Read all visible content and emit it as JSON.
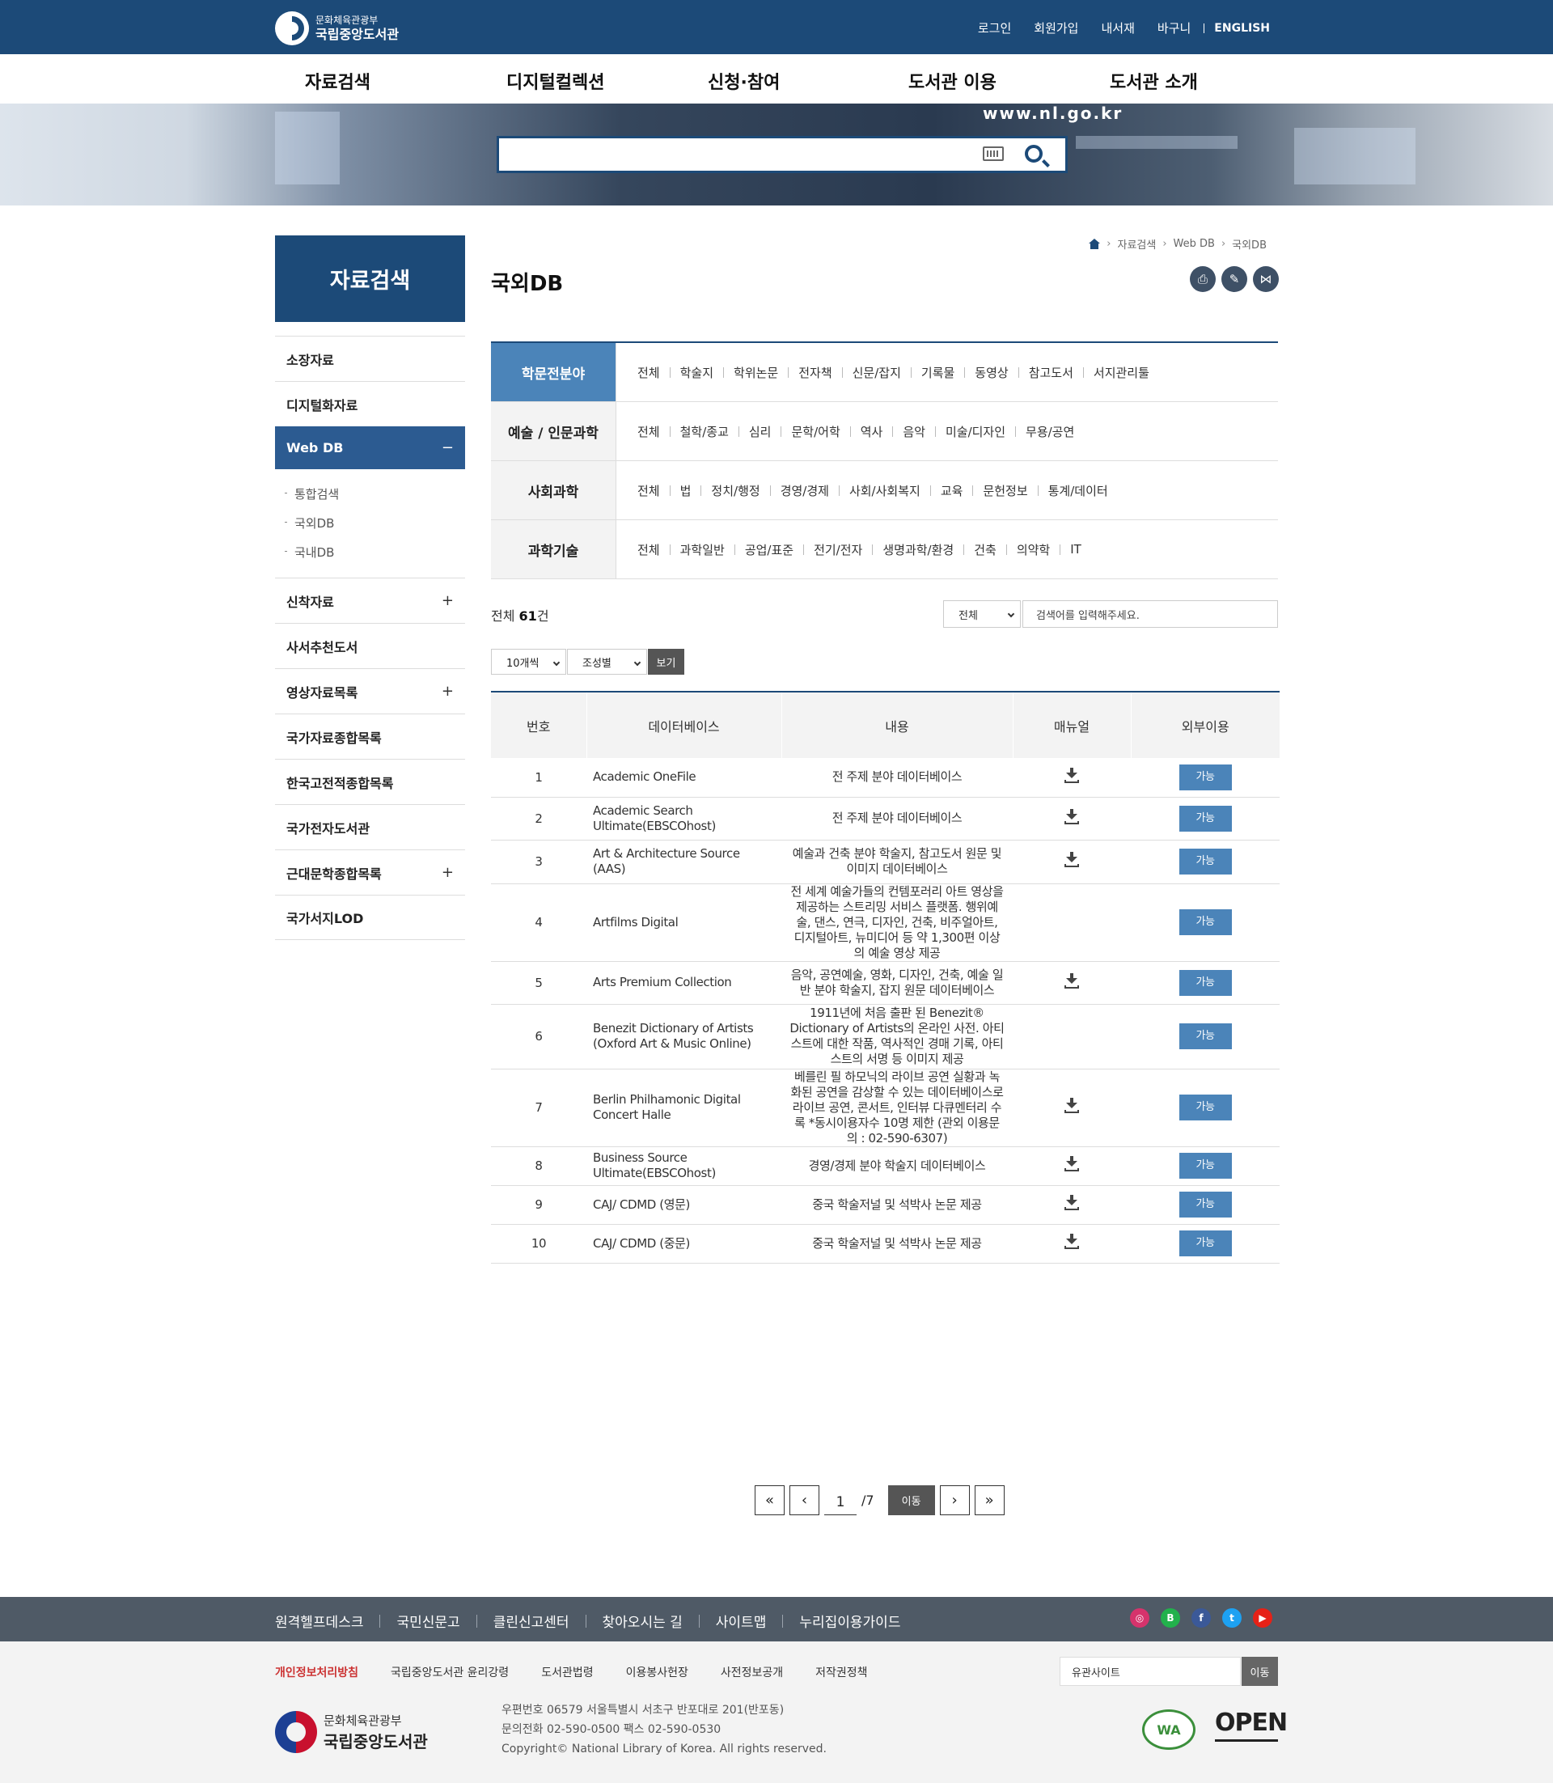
{
  "header": {
    "logo_line1": "문화체육관광부",
    "logo_line2": "국립중앙도서관",
    "links": [
      "로그인",
      "회원가입",
      "내서재",
      "바구니"
    ],
    "english": "ENGLISH"
  },
  "gnb": [
    "자료검색",
    "디지털컬렉션",
    "신청·참여",
    "도서관 이용",
    "도서관 소개"
  ],
  "hero": {
    "url_text": "www.nl.go.kr",
    "search_placeholder": ""
  },
  "sidebar": {
    "title": "자료검색",
    "items": [
      {
        "label": "소장자료",
        "plus": ""
      },
      {
        "label": "디지털화자료",
        "plus": ""
      },
      {
        "label": "Web DB",
        "plus": "−"
      },
      {
        "label": "신착자료",
        "plus": "+"
      },
      {
        "label": "사서추천도서",
        "plus": ""
      },
      {
        "label": "영상자료목록",
        "plus": "+"
      },
      {
        "label": "국가자료종합목록",
        "plus": ""
      },
      {
        "label": "한국고전적종합목록",
        "plus": ""
      },
      {
        "label": "국가전자도서관",
        "plus": ""
      },
      {
        "label": "근대문학종합목록",
        "plus": "+"
      },
      {
        "label": "국가서지LOD",
        "plus": ""
      }
    ],
    "sub_items": [
      "통합검색",
      "국외DB",
      "국내DB"
    ]
  },
  "breadcrumb": [
    "자료검색",
    "Web DB",
    "국외DB"
  ],
  "page": {
    "title": "국외DB"
  },
  "tools": [
    "print-icon",
    "pin-icon",
    "share-icon"
  ],
  "categories": [
    {
      "head": "학문전분야",
      "items": [
        "전체",
        "학술지",
        "학위논문",
        "전자책",
        "신문/잡지",
        "기록물",
        "동영상",
        "참고도서",
        "서지관리툴"
      ]
    },
    {
      "head": "예술 / 인문과학",
      "items": [
        "전체",
        "철학/종교",
        "심리",
        "문학/어학",
        "역사",
        "음악",
        "미술/디자인",
        "무용/공연"
      ]
    },
    {
      "head": "사회과학",
      "items": [
        "전체",
        "법",
        "정치/행정",
        "경영/경제",
        "사회/사회복지",
        "교육",
        "문헌정보",
        "통계/데이터"
      ]
    },
    {
      "head": "과학기술",
      "items": [
        "전체",
        "과학일반",
        "공업/표준",
        "전기/전자",
        "생명과학/환경",
        "건축",
        "의약학",
        "IT"
      ]
    }
  ],
  "results": {
    "total_prefix": "전체",
    "total_count": "61",
    "total_suffix": "건",
    "filter_select": "전체",
    "filter_placeholder": "검색어를 입력해주세요.",
    "per_page": "10개씩",
    "sort": "조성별",
    "view_btn": "보기"
  },
  "table": {
    "headers": [
      "번호",
      "데이터베이스",
      "내용",
      "매뉴얼",
      "외부이용"
    ],
    "rows": [
      {
        "no": "1",
        "db": "Academic OneFile",
        "desc": "전 주제 분야 데이터베이스",
        "manual": true,
        "use": "가능"
      },
      {
        "no": "2",
        "db": "Academic Search Ultimate(EBSCOhost)",
        "desc": "전 주제 분야 데이터베이스",
        "manual": true,
        "use": "가능"
      },
      {
        "no": "3",
        "db": "Art & Architecture Source (AAS)",
        "desc": "예술과 건축 분야 학술지, 참고도서 원문 및 이미지 데이터베이스",
        "manual": true,
        "use": "가능"
      },
      {
        "no": "4",
        "db": "Artfilms Digital",
        "desc": "전 세계 예술가들의 컨템포러리 아트 영상을 제공하는 스트리밍 서비스 플랫폼. 행위예술, 댄스, 연극, 디자인, 건축, 비주얼아트, 디지털아트, 뉴미디어 등 약 1,300편 이상의 예술 영상 제공",
        "manual": false,
        "use": "가능"
      },
      {
        "no": "5",
        "db": "Arts Premium Collection",
        "desc": "음악, 공연예술, 영화, 디자인, 건축, 예술 일반 분야 학술지, 잡지 원문 데이터베이스",
        "manual": true,
        "use": "가능"
      },
      {
        "no": "6",
        "db": "Benezit Dictionary of Artists (Oxford Art & Music Online)",
        "desc": "1911년에 처음 출판 된 Benezit® Dictionary of Artists의 온라인 사전. 아티스트에 대한 작품, 역사적인 경매 기록, 아티스트의 서명 등 이미지 제공",
        "manual": false,
        "use": "가능"
      },
      {
        "no": "7",
        "db": "Berlin Philhamonic Digital Concert Halle",
        "desc": "베를린 필 하모닉의 라이브 공연 실황과 녹화된 공연을 감상할 수 있는 데이터베이스로 라이브 공연, 콘서트, 인터뷰 다큐멘터리 수록 *동시이용자수 10명 제한 (관외 이용문의 : 02-590-6307)",
        "manual": true,
        "use": "가능"
      },
      {
        "no": "8",
        "db": "Business Source Ultimate(EBSCOhost)",
        "desc": "경영/경제 분야 학술지 데이터베이스",
        "manual": true,
        "use": "가능"
      },
      {
        "no": "9",
        "db": "CAJ/ CDMD (영문)",
        "desc": "중국 학술저널 및 석박사 논문 제공",
        "manual": true,
        "use": "가능"
      },
      {
        "no": "10",
        "db": "CAJ/ CDMD (중문)",
        "desc": "중국 학술저널 및 석박사 논문 제공",
        "manual": true,
        "use": "가능"
      }
    ]
  },
  "pager": {
    "current": "1",
    "total": "/7",
    "go": "이동"
  },
  "footer": {
    "links": [
      "원격헬프데스크",
      "국민신문고",
      "클린신고센터",
      "찾아오시는 길",
      "사이트맵",
      "누리집이용가이드"
    ],
    "social": [
      {
        "name": "instagram-icon",
        "glyph": "◎",
        "color": "#d6336c"
      },
      {
        "name": "blog-icon",
        "glyph": "B",
        "color": "#22b14c"
      },
      {
        "name": "facebook-icon",
        "glyph": "f",
        "color": "#3b5998"
      },
      {
        "name": "twitter-icon",
        "glyph": "t",
        "color": "#1da1f2"
      },
      {
        "name": "youtube-icon",
        "glyph": "▶",
        "color": "#e62117"
      }
    ],
    "policy": [
      "개인정보처리방침",
      "국립중앙도서관 윤리강령",
      "도서관법령",
      "이용봉사헌장",
      "사전정보공개",
      "저작권정책"
    ],
    "family_site": "유관사이트",
    "family_go": "이동",
    "logo_line1": "문화체육관광부",
    "logo_line2": "국립중앙도서관",
    "address": "우편번호 06579 서울특별시 서초구 반포대로 201(반포동)",
    "phone": "문의전화 02-590-0500 팩스 02-590-0530",
    "copyright": "Copyright© National Library of Korea. All rights reserved.",
    "wa_badge": "WA",
    "open_badge": "OPEN"
  }
}
